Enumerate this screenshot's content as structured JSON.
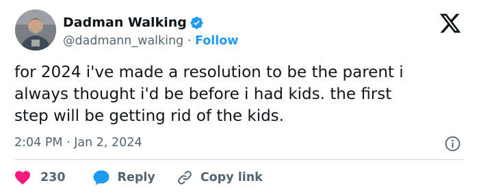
{
  "author": {
    "name": "Dadman Walking",
    "handle": "@dadmann_walking",
    "separator": "·",
    "follow_label": "Follow",
    "verified": true
  },
  "tweet": {
    "text": "for 2024 i've made a resolution to be the parent i\nalways thought i'd be before i had kids. the first\nstep will be getting rid of the kids.",
    "time": "2:04 PM",
    "separator": "·",
    "date": "Jan 2, 2024"
  },
  "actions": {
    "like_count": "230",
    "reply_label": "Reply",
    "copy_link_label": "Copy link"
  },
  "colors": {
    "accent": "#1d9bf0",
    "like": "#f91880",
    "text": "#0f1419",
    "secondary": "#536471",
    "divider": "#cfd9de"
  },
  "icons": [
    "verified-badge-icon",
    "x-logo-icon",
    "info-icon",
    "heart-icon",
    "reply-bubble-icon",
    "link-icon"
  ]
}
